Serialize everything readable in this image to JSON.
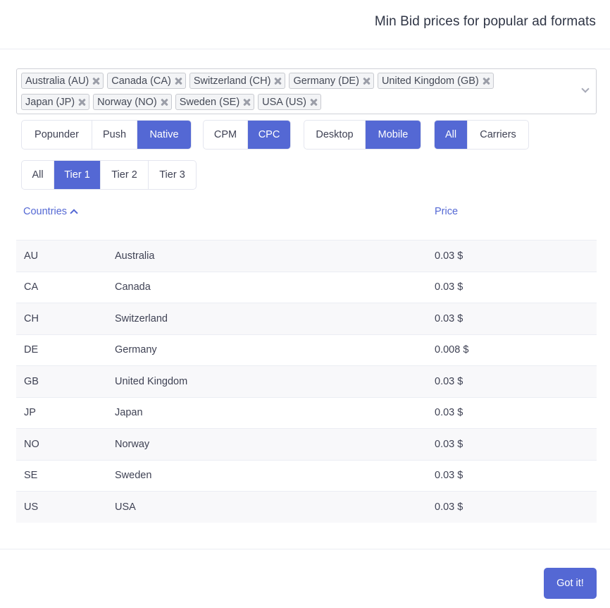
{
  "header": {
    "title": "Min Bid prices for popular ad formats"
  },
  "country_select": {
    "selected": [
      [
        "Australia (AU)",
        "Canada (CA)",
        "Switzerland (CH)",
        "Germany (DE)",
        "United Kingdom (GB)"
      ],
      [
        "Japan (JP)",
        "Norway (NO)",
        "Sweden (SE)",
        "USA (US)"
      ]
    ],
    "remove_icon": "close-x-icon",
    "dropdown_icon": "chevron-down-icon"
  },
  "filters": {
    "ad_format": {
      "options": [
        "Popunder",
        "Push",
        "Native"
      ],
      "active": "Native"
    },
    "pricing_model": {
      "options": [
        "CPM",
        "CPC"
      ],
      "active": "CPC"
    },
    "device": {
      "options": [
        "Desktop",
        "Mobile"
      ],
      "active": "Mobile"
    },
    "connection": {
      "options": [
        "All",
        "Carriers"
      ],
      "active": "All"
    },
    "tier": {
      "options": [
        "All",
        "Tier 1",
        "Tier 2",
        "Tier 3"
      ],
      "active": "Tier 1"
    }
  },
  "table": {
    "columns": {
      "countries": "Countries",
      "price": "Price"
    },
    "sort": {
      "column": "countries",
      "direction": "ascending",
      "icon": "chevron-up-icon"
    },
    "rows": [
      {
        "code": "AU",
        "name": "Australia",
        "price": "0.03 $"
      },
      {
        "code": "CA",
        "name": "Canada",
        "price": "0.03 $"
      },
      {
        "code": "CH",
        "name": "Switzerland",
        "price": "0.03 $"
      },
      {
        "code": "DE",
        "name": "Germany",
        "price": "0.008 $"
      },
      {
        "code": "GB",
        "name": "United Kingdom",
        "price": "0.03 $"
      },
      {
        "code": "JP",
        "name": "Japan",
        "price": "0.03 $"
      },
      {
        "code": "NO",
        "name": "Norway",
        "price": "0.03 $"
      },
      {
        "code": "SE",
        "name": "Sweden",
        "price": "0.03 $"
      },
      {
        "code": "US",
        "name": "USA",
        "price": "0.03 $"
      }
    ]
  },
  "footer": {
    "confirm_label": "Got it!"
  },
  "colors": {
    "accent": "#5468d4",
    "text": "#3f4254",
    "row_stripe": "#f8f8fa",
    "border": "#e4e6ef"
  }
}
